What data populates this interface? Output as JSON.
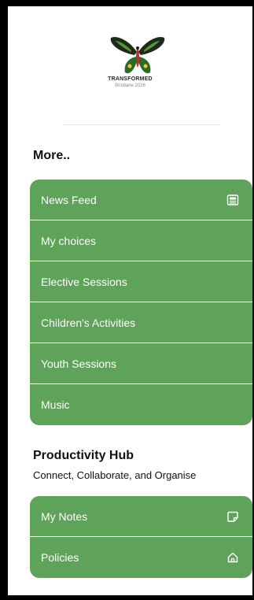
{
  "brand": {
    "name": "TRANSFORMED",
    "subtitle": "Brisbane 2026"
  },
  "more_section": {
    "title": "More..",
    "items": [
      {
        "label": "News Feed",
        "icon": "newspaper-icon"
      },
      {
        "label": "My choices"
      },
      {
        "label": "Elective Sessions"
      },
      {
        "label": "Children's Activities"
      },
      {
        "label": "Youth Sessions"
      },
      {
        "label": "Music"
      }
    ]
  },
  "productivity_hub": {
    "title": "Productivity Hub",
    "subtitle": "Connect, Collaborate, and Organise",
    "items": [
      {
        "label": "My Notes",
        "icon": "note-icon"
      },
      {
        "label": "Policies",
        "icon": "home-icon"
      }
    ]
  },
  "colors": {
    "menu_background": "#5fa35a",
    "menu_text": "#ffffff",
    "page_background": "#ffffff",
    "frame": "#000000"
  }
}
